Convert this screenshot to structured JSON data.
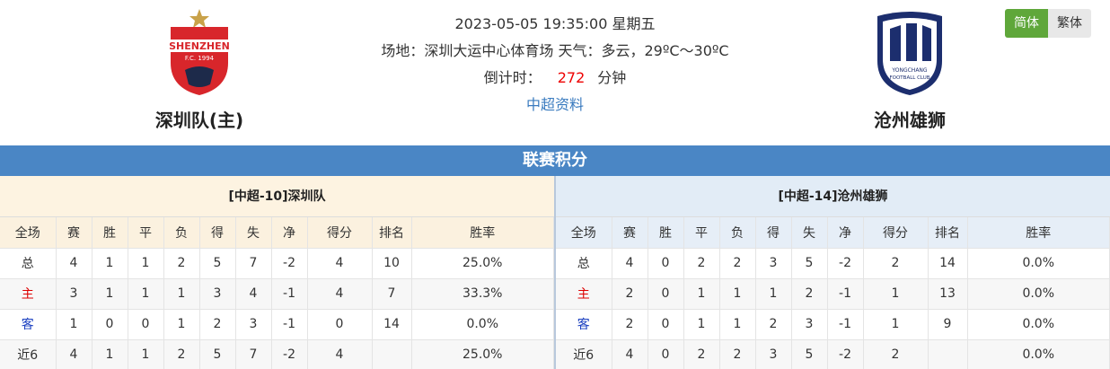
{
  "match": {
    "datetime": "2023-05-05 19:35:00 星期五",
    "venue_line": "场地：深圳大运中心体育场 天气：多云，29ºC～30ºC",
    "countdown_label": "倒计时：",
    "countdown_value": "272",
    "countdown_unit": "分钟",
    "league_link": "中超资料"
  },
  "home_team": {
    "name": "深圳队(主)",
    "logo_text": "SHENZHEN",
    "logo_sub": "F.C. 1994"
  },
  "away_team": {
    "name": "沧州雄狮",
    "logo_text": "YONGCHANG",
    "logo_sub": "FOOTBALL CLUB"
  },
  "lang": {
    "simplified": "简体",
    "traditional": "繁体"
  },
  "section_title": "联赛积分",
  "columns": [
    "全场",
    "赛",
    "胜",
    "平",
    "负",
    "得",
    "失",
    "净",
    "得分",
    "排名",
    "胜率"
  ],
  "home_table": {
    "title": "[中超-10]深圳队",
    "rows": [
      [
        "总",
        "4",
        "1",
        "1",
        "2",
        "5",
        "7",
        "-2",
        "4",
        "10",
        "25.0%"
      ],
      [
        "主",
        "3",
        "1",
        "1",
        "1",
        "3",
        "4",
        "-1",
        "4",
        "7",
        "33.3%"
      ],
      [
        "客",
        "1",
        "0",
        "0",
        "1",
        "2",
        "3",
        "-1",
        "0",
        "14",
        "0.0%"
      ],
      [
        "近6",
        "4",
        "1",
        "1",
        "2",
        "5",
        "7",
        "-2",
        "4",
        "",
        "25.0%"
      ]
    ]
  },
  "away_table": {
    "title": "[中超-14]沧州雄狮",
    "rows": [
      [
        "总",
        "4",
        "0",
        "2",
        "2",
        "3",
        "5",
        "-2",
        "2",
        "14",
        "0.0%"
      ],
      [
        "主",
        "2",
        "0",
        "1",
        "1",
        "1",
        "2",
        "-1",
        "1",
        "13",
        "0.0%"
      ],
      [
        "客",
        "2",
        "0",
        "1",
        "1",
        "2",
        "3",
        "-1",
        "1",
        "9",
        "0.0%"
      ],
      [
        "近6",
        "4",
        "0",
        "2",
        "2",
        "3",
        "5",
        "-2",
        "2",
        "",
        "0.0%"
      ]
    ]
  },
  "colors": {
    "section_bar": "#4a86c5",
    "active_lang": "#5fa73a",
    "countdown": "#e00000",
    "home_label": "#d00000",
    "away_label": "#1a3fc0"
  }
}
